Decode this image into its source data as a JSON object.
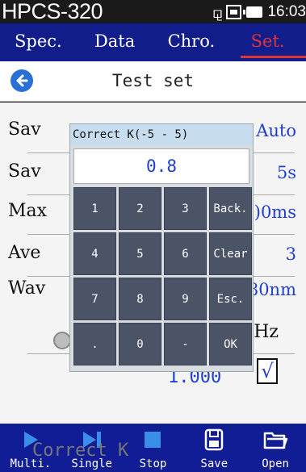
{
  "status": {
    "app_title": "HPCS-320",
    "clock": "16:03"
  },
  "tabs": [
    {
      "label": "Spec."
    },
    {
      "label": "Data"
    },
    {
      "label": "Chro."
    },
    {
      "label": "Set."
    }
  ],
  "header": {
    "title": "Test set"
  },
  "settings": [
    {
      "label": "Sav",
      "value": "Auto"
    },
    {
      "label": "Sav",
      "value": "5s"
    },
    {
      "label": "Max",
      "value": ")0ms"
    },
    {
      "label": "Ave",
      "value": "3"
    },
    {
      "label": "Wav",
      "value": "80nm"
    }
  ],
  "hz_label": "Hz",
  "coeff_value": "1.000",
  "checkbox_mark": "√",
  "dialog": {
    "title": "Correct K(-5 - 5)",
    "display_value": "0.8",
    "keys": [
      "1",
      "2",
      "3",
      "Back.",
      "4",
      "5",
      "6",
      "Clear",
      "7",
      "8",
      "9",
      "Esc.",
      ".",
      "0",
      "-",
      "OK"
    ]
  },
  "ghost_text": "Correct K",
  "toolbar": [
    {
      "label": "Multi.",
      "icon": "play-icon"
    },
    {
      "label": "Single",
      "icon": "step-icon"
    },
    {
      "label": "Stop",
      "icon": "stop-icon"
    },
    {
      "label": "Save",
      "icon": "save-icon"
    },
    {
      "label": "Open",
      "icon": "folder-icon"
    }
  ],
  "colors": {
    "tab_bar": "#121d8c",
    "active_tab": "#e23434",
    "value_blue": "#1f3fd0",
    "toolbar": "#101d94",
    "keypad_key": "#4b5366"
  }
}
